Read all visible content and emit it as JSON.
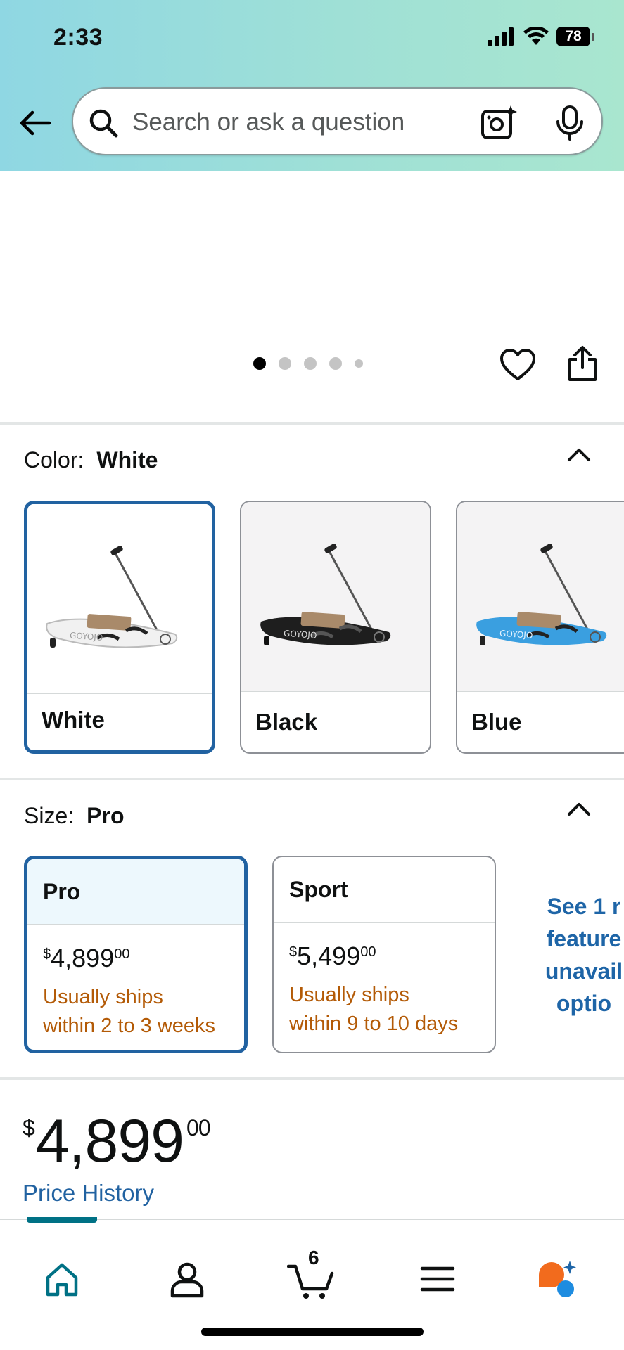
{
  "status_bar": {
    "time": "2:33",
    "battery": "78"
  },
  "search": {
    "placeholder": "Search or ask a question"
  },
  "gallery": {
    "dot_count": 5,
    "active_index": 0
  },
  "color_section": {
    "label": "Color:",
    "selected": "White",
    "options": [
      {
        "label": "White",
        "board_color": "#f1f1f1"
      },
      {
        "label": "Black",
        "board_color": "#1e1e1e"
      },
      {
        "label": "Blue",
        "board_color": "#3a9fe0"
      }
    ],
    "brand_text": "GOYOJO"
  },
  "size_section": {
    "label": "Size:",
    "selected": "Pro",
    "options": [
      {
        "label": "Pro",
        "price_symbol": "$",
        "price_whole": "4,899",
        "price_cents": "00",
        "ship_line1": "Usually ships",
        "ship_line2": "within 2 to 3 weeks"
      },
      {
        "label": "Sport",
        "price_symbol": "$",
        "price_whole": "5,499",
        "price_cents": "00",
        "ship_line1": "Usually ships",
        "ship_line2": "within 9 to 10 days"
      }
    ],
    "see_more_lines": [
      "See 1 r",
      "feature",
      "unavail",
      "optio"
    ]
  },
  "price": {
    "symbol": "$",
    "whole": "4,899",
    "cents": "00",
    "history_link": "Price History"
  },
  "bottom_nav": {
    "cart_count": "6"
  },
  "colors": {
    "accent_blue": "#2162a1",
    "ship_orange": "#b35a06",
    "nav_teal": "#007185"
  }
}
